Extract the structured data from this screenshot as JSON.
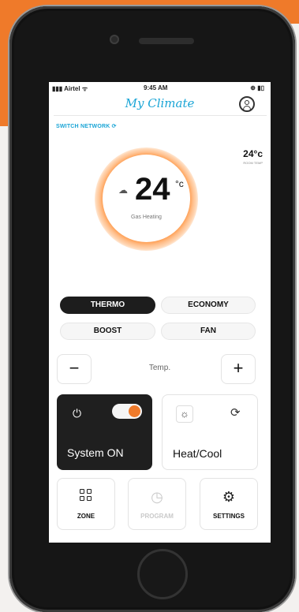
{
  "status_bar": {
    "carrier": "Airtel",
    "time": "9:45 AM",
    "battery": "⊕ ▮▯"
  },
  "header": {
    "title": "My Climate"
  },
  "network": {
    "switch_label": "SWITCH NETWORK ⟳"
  },
  "room": {
    "temp": "24°c",
    "label": "ROOM TEMP"
  },
  "dial": {
    "temp": "24",
    "unit": "°c",
    "mode": "Gas Heating"
  },
  "modes": [
    {
      "label": "THERMO",
      "active": true
    },
    {
      "label": "ECONOMY",
      "active": false
    },
    {
      "label": "BOOST",
      "active": false
    },
    {
      "label": "FAN",
      "active": false
    }
  ],
  "temp_control": {
    "minus": "−",
    "label": "Temp.",
    "plus": "+"
  },
  "system": {
    "label": "System ON",
    "on": true
  },
  "heat_cool": {
    "label": "Heat/Cool"
  },
  "tiles": [
    {
      "label": "ZONE",
      "icon": "grid-icon"
    },
    {
      "label": "PROGRAM",
      "icon": "clock-icon",
      "disabled": true
    },
    {
      "label": "SETTINGS",
      "icon": "gear-icon"
    }
  ],
  "colors": {
    "accent": "#ef7a2a",
    "brand": "#1aa5d6",
    "dark": "#1f1f1f"
  }
}
